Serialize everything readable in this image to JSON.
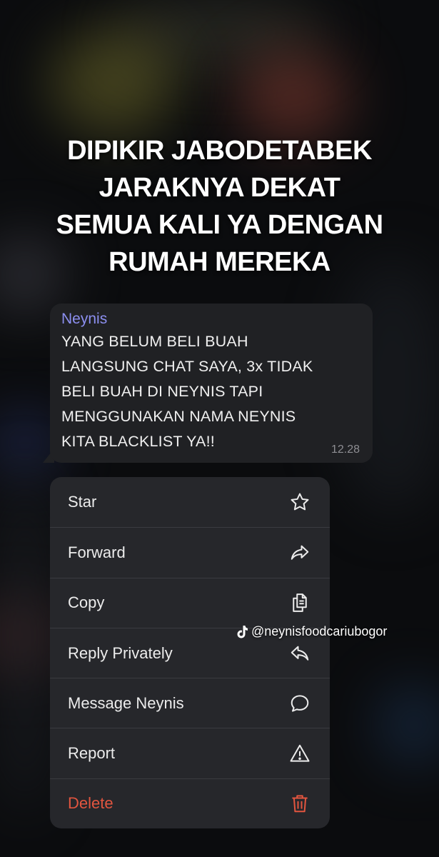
{
  "headline": {
    "lines": [
      "DIPIKIR JABODETABEK",
      "JARAKNYA DEKAT",
      "SEMUA KALI YA DENGAN",
      "RUMAH MEREKA"
    ]
  },
  "message": {
    "sender": "Neynis",
    "lines": [
      "YANG BELUM BELI BUAH",
      "LANGSUNG CHAT SAYA, 3x TIDAK",
      "BELI BUAH DI NEYNIS TAPI",
      "MENGGUNAKAN NAMA NEYNIS",
      "KITA BLACKLIST YA!!"
    ],
    "time": "12.28"
  },
  "context_menu": {
    "items": [
      {
        "label": "Star",
        "icon": "star-icon"
      },
      {
        "label": "Forward",
        "icon": "forward-icon"
      },
      {
        "label": "Copy",
        "icon": "copy-icon"
      },
      {
        "label": "Reply Privately",
        "icon": "reply-icon"
      },
      {
        "label": "Message Neynis",
        "icon": "chat-bubble-icon"
      },
      {
        "label": "Report",
        "icon": "warning-icon"
      },
      {
        "label": "Delete",
        "icon": "trash-icon"
      }
    ],
    "delete_color": "#e2553f"
  },
  "watermark": {
    "handle": "@neynisfoodcariubogor",
    "icon": "tiktok-icon"
  },
  "colors": {
    "sender_name": "#8c8ff0",
    "bubble_bg": "#202124",
    "menu_bg": "#26272b"
  }
}
